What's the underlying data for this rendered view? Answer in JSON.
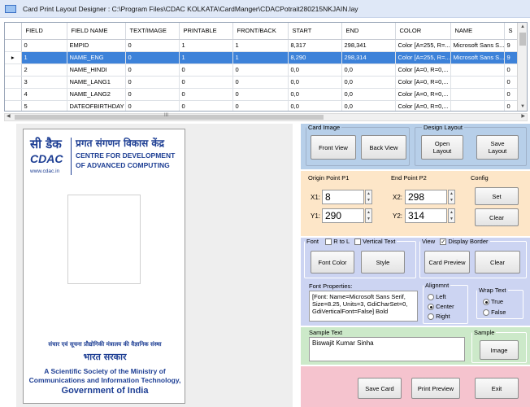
{
  "window": {
    "title": "Card Print Layout Designer : C:\\Program Files\\CDAC KOLKATA\\CardManger\\CDACPotrait280215NKJAIN.lay"
  },
  "grid": {
    "columns": [
      "FIELD",
      "FIELD NAME",
      "TEXT/IMAGE",
      "PRINTABLE",
      "FRONT/BACK",
      "START",
      "END",
      "COLOR",
      "NAME",
      "S"
    ],
    "rows": [
      {
        "indicator": "",
        "cells": [
          "0",
          "EMPID",
          "0",
          "1",
          "1",
          "8,317",
          "298,341",
          "Color [A=255, R=...",
          "Microsoft Sans S...",
          "9"
        ]
      },
      {
        "indicator": "▸",
        "cells": [
          "1",
          "NAME_ENG",
          "0",
          "1",
          "1",
          "8,290",
          "298,314",
          "Color [A=255, R=...",
          "Microsoft Sans S...",
          "9"
        ]
      },
      {
        "indicator": "",
        "cells": [
          "2",
          "NAME_HINDI",
          "0",
          "0",
          "0",
          "0,0",
          "0,0",
          "Color [A=0, R=0,...",
          "",
          "0"
        ]
      },
      {
        "indicator": "",
        "cells": [
          "3",
          "NAME_LANG1",
          "0",
          "0",
          "0",
          "0,0",
          "0,0",
          "Color [A=0, R=0,...",
          "",
          "0"
        ]
      },
      {
        "indicator": "",
        "cells": [
          "4",
          "NAME_LANG2",
          "0",
          "0",
          "0",
          "0,0",
          "0,0",
          "Color [A=0, R=0,...",
          "",
          "0"
        ]
      },
      {
        "indicator": "",
        "cells": [
          "5",
          "DATEOFBIRTHDAY",
          "0",
          "0",
          "0",
          "0,0",
          "0,0",
          "Color [A=0, R=0,...",
          "",
          "0"
        ]
      }
    ],
    "hscroll_marker": "III"
  },
  "card": {
    "logo_hindi_short": "सी डैक",
    "logo_short": "CDAC",
    "logo_url": "www.cdac.in",
    "hindi_name": "प्रगत संगणन विकास केंद्र",
    "english_line1": "CENTRE FOR DEVELOPMENT",
    "english_line2": "OF ADVANCED COMPUTING",
    "footer_hindi1": "संचार एवं सूचना प्रौद्योगिकी मंत्रालय की वैज्ञानिक संस्था",
    "footer_hindi2": "भारत सरकार",
    "footer_eng1": "A Scientific Society of the Ministry of",
    "footer_eng2": "Communications and Information Technology,",
    "footer_eng3": "Government of India"
  },
  "card_image": {
    "legend": "Card Image",
    "front_view": "Front View",
    "back_view": "Back View"
  },
  "design_layout": {
    "legend": "Design Layout",
    "open_layout": "Open Layout",
    "save_layout": "Save Layout"
  },
  "origin": {
    "legend": "Origin Point P1",
    "x_label": "X1:",
    "x_value": "8",
    "y_label": "Y1:",
    "y_value": "290"
  },
  "end_point": {
    "legend": "End Point P2",
    "x_label": "X2:",
    "x_value": "298",
    "y_label": "Y2:",
    "y_value": "314"
  },
  "config": {
    "legend": "Config",
    "set": "Set",
    "clear": "Clear"
  },
  "font": {
    "legend": "Font",
    "rtl_label": "R to L",
    "vertical_label": "Vertical Text",
    "font_color": "Font Color",
    "style": "Style",
    "properties_label": "Font Properties:",
    "properties_value": "[Font: Name=Microsoft Sans Serif, Size=8.25, Units=3, GdiCharSet=0, GdiVerticalFont=False] Bold"
  },
  "view": {
    "legend": "View",
    "display_border_label": "Display Border",
    "display_border_checked": true,
    "card_preview": "Card Preview",
    "clear": "Clear"
  },
  "alignment": {
    "legend": "Alignmnt",
    "left": "Left",
    "center": "Center",
    "right": "Right",
    "selected": "Center"
  },
  "wrap": {
    "legend": "Wrap Text",
    "true_label": "True",
    "false_label": "False",
    "selected": "True"
  },
  "sample": {
    "text_label": "Sample Text",
    "text_value": "Biswajit Kumar Sinha",
    "legend": "Sample",
    "image_button": "Image"
  },
  "actions": {
    "save_card": "Save Card",
    "print_preview": "Print Preview",
    "exit": "Exit"
  }
}
